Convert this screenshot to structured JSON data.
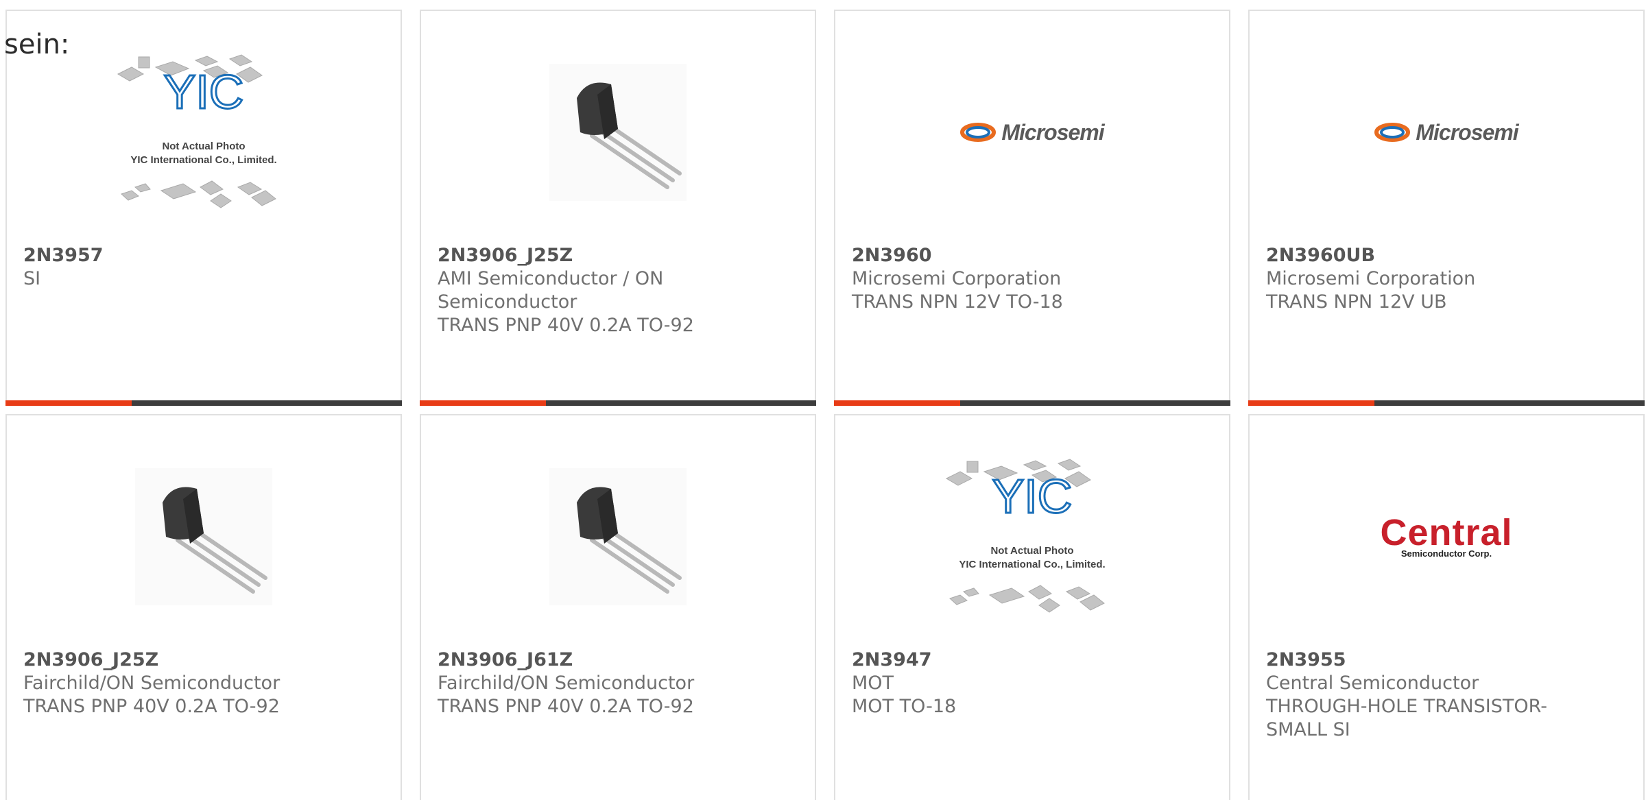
{
  "intro_text": "sein:",
  "products": [
    {
      "part": "2N3957",
      "lines": [
        "SI"
      ],
      "image": "yic-not-actual-photo"
    },
    {
      "part": "2N3906_J25Z",
      "lines": [
        "AMI Semiconductor / ON",
        "Semiconductor",
        "TRANS PNP 40V 0.2A TO-92"
      ],
      "image": "to92-transistor"
    },
    {
      "part": "2N3960",
      "lines": [
        "Microsemi Corporation",
        "TRANS NPN 12V TO-18"
      ],
      "image": "microsemi-logo"
    },
    {
      "part": "2N3960UB",
      "lines": [
        "Microsemi Corporation",
        "TRANS NPN 12V UB"
      ],
      "image": "microsemi-logo"
    },
    {
      "part": "2N3906_J25Z",
      "lines": [
        "Fairchild/ON Semiconductor",
        "TRANS PNP 40V 0.2A TO-92"
      ],
      "image": "to92-transistor"
    },
    {
      "part": "2N3906_J61Z",
      "lines": [
        "Fairchild/ON Semiconductor",
        "TRANS PNP 40V 0.2A TO-92"
      ],
      "image": "to92-transistor"
    },
    {
      "part": "2N3947",
      "lines": [
        "MOT",
        "MOT TO-18"
      ],
      "image": "yic-not-actual-photo"
    },
    {
      "part": "2N3955",
      "lines": [
        "Central Semiconductor",
        "THROUGH-HOLE TRANSISTOR-",
        "SMALL SI"
      ],
      "image": "central-logo"
    }
  ],
  "yic_caption": {
    "line1": "Not Actual Photo",
    "line2": "YIC International Co., Limited.",
    "logo": "YIC"
  },
  "microsemi_text": "Microsemi",
  "central_logo": {
    "big": "Central",
    "small": "Semiconductor Corp."
  },
  "colors": {
    "accent": "#e83c16",
    "bar": "#3d3d3d",
    "border": "#e0e0e0",
    "text": "#707070"
  }
}
